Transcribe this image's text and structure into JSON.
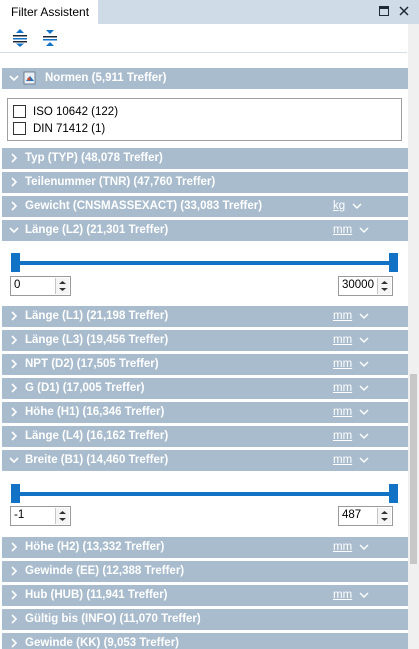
{
  "panel": {
    "title": "Filter Assistent"
  },
  "normen": {
    "label": "Normen (5,911 Treffer)",
    "options": [
      {
        "label": "ISO 10642 (122)",
        "checked": false
      },
      {
        "label": "DIN 71412 (1)",
        "checked": false
      }
    ]
  },
  "groups": [
    {
      "label": "Typ (TYP) (48,078 Treffer)",
      "expanded": false,
      "unit": ""
    },
    {
      "label": "Teilenummer (TNR) (47,760 Treffer)",
      "expanded": false,
      "unit": ""
    },
    {
      "label": "Gewicht (CNSMASSEXACT) (33,083 Treffer)",
      "expanded": false,
      "unit": "kg"
    },
    {
      "label": "Länge (L2) (21,301 Treffer)",
      "expanded": true,
      "unit": "mm"
    },
    {
      "label": "Länge (L1) (21,198 Treffer)",
      "expanded": false,
      "unit": "mm"
    },
    {
      "label": "Länge (L3) (19,456 Treffer)",
      "expanded": false,
      "unit": "mm"
    },
    {
      "label": "NPT (D2) (17,505 Treffer)",
      "expanded": false,
      "unit": "mm"
    },
    {
      "label": "G (D1) (17,005 Treffer)",
      "expanded": false,
      "unit": "mm"
    },
    {
      "label": "Höhe (H1) (16,346 Treffer)",
      "expanded": false,
      "unit": "mm"
    },
    {
      "label": "Länge (L4) (16,162 Treffer)",
      "expanded": false,
      "unit": "mm"
    },
    {
      "label": "Breite (B1) (14,460 Treffer)",
      "expanded": true,
      "unit": "mm"
    },
    {
      "label": "Höhe (H2) (13,332 Treffer)",
      "expanded": false,
      "unit": "mm"
    },
    {
      "label": "Gewinde (EE) (12,388 Treffer)",
      "expanded": false,
      "unit": ""
    },
    {
      "label": "Hub (HUB) (11,941 Treffer)",
      "expanded": false,
      "unit": "mm"
    },
    {
      "label": "Gültig bis (INFO) (11,070 Treffer)",
      "expanded": false,
      "unit": ""
    },
    {
      "label": "Gewinde (KK) (9,053 Treffer)",
      "expanded": false,
      "unit": ""
    }
  ],
  "range_l2": {
    "min": "0",
    "max": "30000"
  },
  "range_b1": {
    "min": "-1",
    "max": "487"
  },
  "colors": {
    "header": "#a9bccd",
    "accent": "#1272c6",
    "titlebar": "#cfdbe7"
  },
  "icons": {
    "expand_all": "expand-all-icon",
    "collapse_all": "collapse-all-icon",
    "restore": "restore-window-icon",
    "close": "close-icon",
    "normen": "norm-document-icon"
  }
}
